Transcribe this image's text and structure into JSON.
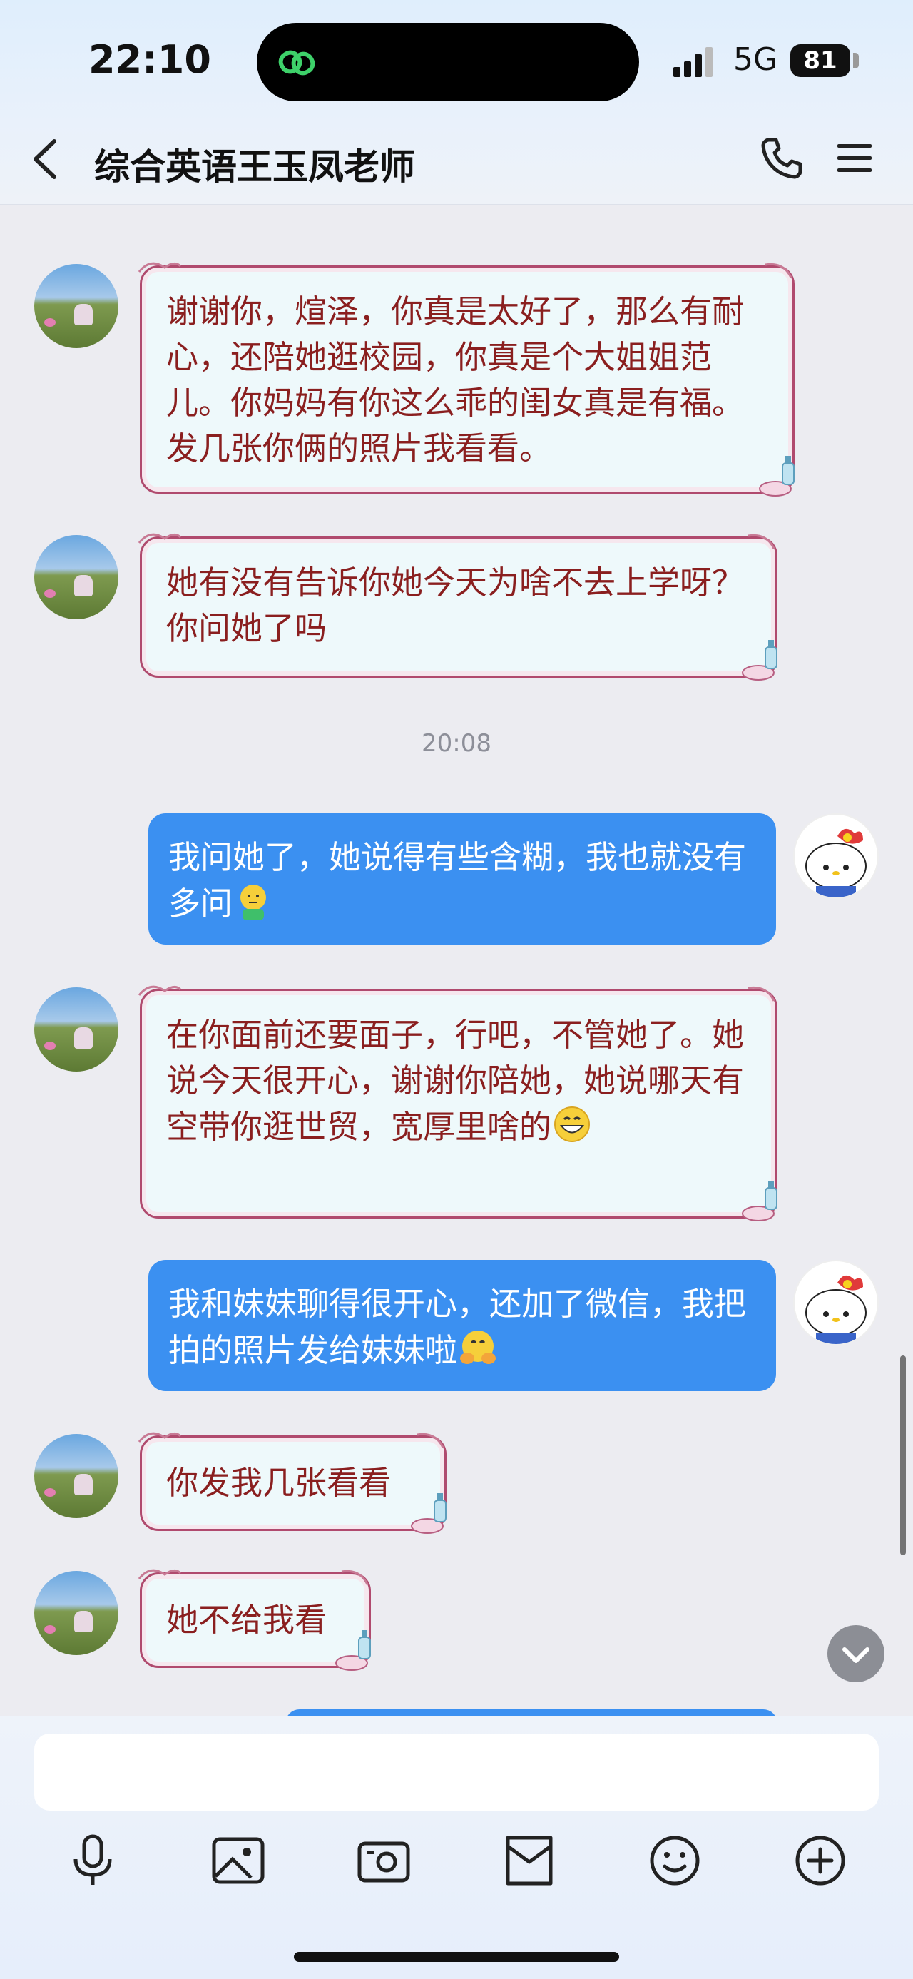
{
  "status_bar": {
    "time": "22:10",
    "network": "5G",
    "battery": "81"
  },
  "header": {
    "title": "综合英语王玉凤老师"
  },
  "messages": [
    {
      "side": "left",
      "text": "谢谢你，煊泽，你真是太好了，那么有耐心，还陪她逛校园，你真是个大姐姐范儿。你妈妈有你这么乖的闺女真是有福。发几张你俩的照片我看看。"
    },
    {
      "side": "left",
      "text": "她有没有告诉你她今天为啥不去上学呀？你问她了吗"
    },
    {
      "side": "time",
      "text": "20:08"
    },
    {
      "side": "right",
      "text": "我问她了，她说得有些含糊，我也就没有多问"
    },
    {
      "side": "left",
      "text": "在你面前还要面子，行吧，不管她了。她说今天很开心，谢谢你陪她，她说哪天有空带你逛世贸，宽厚里啥的"
    },
    {
      "side": "right",
      "text": "我和妹妹聊得很开心，还加了微信，我把拍的照片发给妹妹啦"
    },
    {
      "side": "left",
      "text": "你发我几张看看"
    },
    {
      "side": "left",
      "text": "她不给我看"
    }
  ],
  "input": {
    "value": ""
  },
  "colors": {
    "accent": "#3b90f1",
    "peer_text": "#8a1f1f",
    "peer_border": "#b04a6e"
  },
  "icons": [
    "back-icon",
    "phone-icon",
    "menu-icon",
    "mic-icon",
    "image-icon",
    "camera-icon",
    "folder-icon",
    "emoji-icon",
    "plus-icon",
    "chevron-down-icon"
  ]
}
